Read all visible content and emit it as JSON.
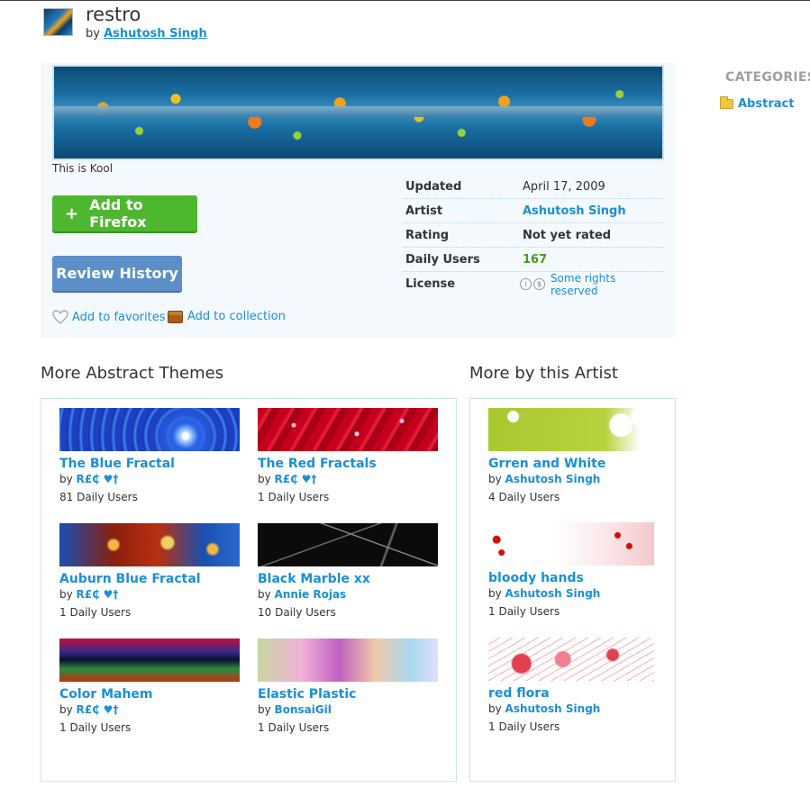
{
  "header": {
    "title": "restro",
    "by_prefix": "by",
    "author": "Ashutosh Singh"
  },
  "main": {
    "description": "This is Kool",
    "add_button": "Add to Firefox",
    "add_icon": "+",
    "review_button": "Review History",
    "favorites_label": "Add to favorites",
    "collection_label": "Add to collection",
    "meta": [
      {
        "key": "Updated",
        "value": "April 17, 2009"
      },
      {
        "key": "Artist",
        "value": "Ashutosh Singh"
      },
      {
        "key": "Rating",
        "value": "Not yet rated"
      },
      {
        "key": "Daily Users",
        "value": "167"
      },
      {
        "key": "License",
        "value": "Some rights reserved"
      }
    ]
  },
  "sidebar": {
    "heading": "CATEGORIES",
    "category": "Abstract"
  },
  "abstract_section": {
    "title": "More Abstract Themes",
    "items": [
      {
        "title": "The Blue Fractal",
        "by": "by",
        "author": "R£₵ ♥†",
        "users": "81 Daily Users"
      },
      {
        "title": "The Red Fractals",
        "by": "by",
        "author": "R£₵ ♥†",
        "users": "1 Daily Users"
      },
      {
        "title": "Auburn Blue Fractal",
        "by": "by",
        "author": "R£₵ ♥†",
        "users": "1 Daily Users"
      },
      {
        "title": "Black Marble xx",
        "by": "by",
        "author": "Annie Rojas",
        "users": "10 Daily Users"
      },
      {
        "title": "Color Mahem",
        "by": "by",
        "author": "R£₵ ♥†",
        "users": "1 Daily Users"
      },
      {
        "title": "Elastic Plastic",
        "by": "by",
        "author": "BonsaiGil",
        "users": "1 Daily Users"
      }
    ]
  },
  "artist_section": {
    "title": "More by this Artist",
    "items": [
      {
        "title": "Grren and White",
        "by": "by",
        "author": "Ashutosh Singh",
        "users": "4 Daily Users"
      },
      {
        "title": "bloody hands",
        "by": "by",
        "author": "Ashutosh Singh",
        "users": "1 Daily Users"
      },
      {
        "title": "red flora",
        "by": "by",
        "author": "Ashutosh Singh",
        "users": "1 Daily Users"
      }
    ]
  },
  "colors": {
    "link": "#1a8fd6",
    "add_button": "#4db82f",
    "review_button": "#5c8fc8",
    "daily_users_value": "#4a9a1e",
    "panel_bg": "#f4f9fd"
  }
}
